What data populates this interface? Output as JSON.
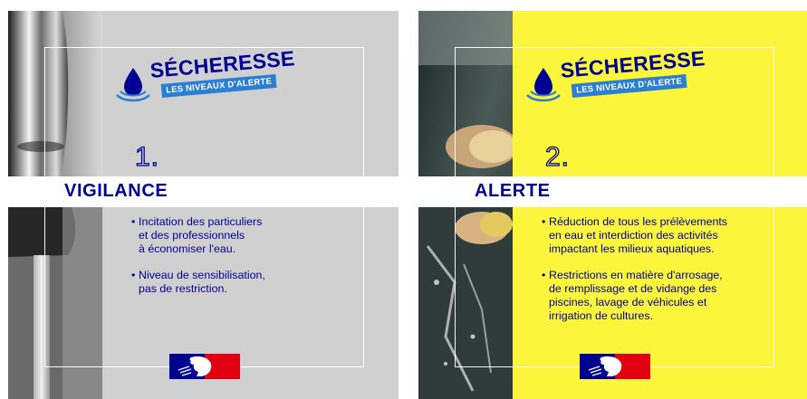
{
  "colors": {
    "navy": "#000091",
    "tag_blue": "#2b7fd1",
    "gray_panel": "#d0d0d0",
    "yellow_panel": "#fbf53b",
    "flag_blue": "#000091",
    "flag_red": "#e1000f"
  },
  "logo": {
    "word": "SÉCHERESSE",
    "tagline": "LES NIVEAUX D'ALERTE",
    "icon": "water-drop-icon"
  },
  "panels": [
    {
      "number": "1.",
      "name": "VIGILANCE",
      "background": "gray",
      "photo": "faucet-photo",
      "bullets": [
        "Incitation des particuliers\net des professionnels\nà économiser l'eau.",
        "Niveau de sensibilisation,\npas de restriction."
      ]
    },
    {
      "number": "2.",
      "name": "ALERTE",
      "background": "yellow",
      "photo": "car-wash-photo",
      "bullets": [
        "Réduction de tous les prélèvements\nen eau et interdiction des activités\nimpactant les milieux aquatiques.",
        "Restrictions en matière d'arrosage,\nde remplissage et de vidange des\npiscines, lavage de véhicules et\nirrigation de cultures."
      ]
    }
  ]
}
